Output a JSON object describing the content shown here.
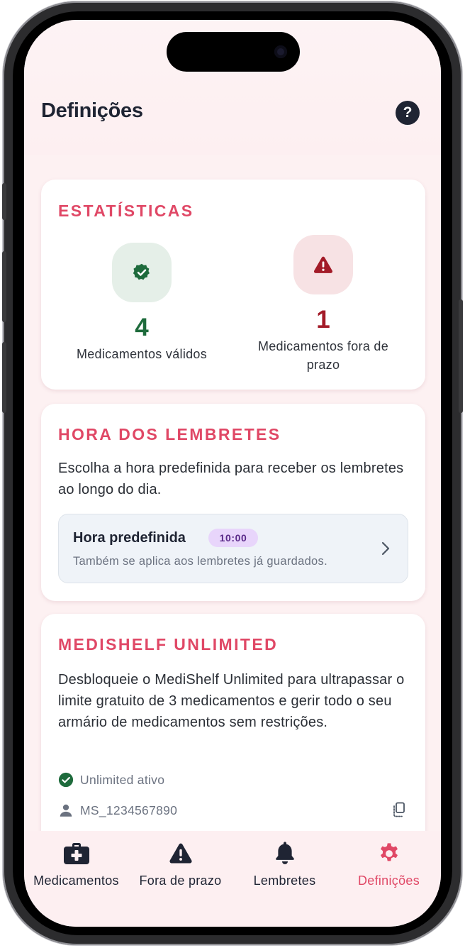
{
  "header": {
    "title": "Definições",
    "help_label": "?"
  },
  "stats": {
    "title": "ESTATÍSTICAS",
    "valid": {
      "count": "4",
      "label": "Medicamentos válidos",
      "icon": "verified-badge-icon",
      "color": "#1e6b3c"
    },
    "expired": {
      "count": "1",
      "label": "Medicamentos fora de prazo",
      "icon": "warning-triangle-icon",
      "color": "#a31b28"
    }
  },
  "reminders": {
    "title": "HORA DOS LEMBRETES",
    "description": "Escolha a hora predefinida para receber os lembretes ao longo do dia.",
    "default_time": {
      "label": "Hora predefinida",
      "time": "10:00",
      "subtitle": "Também se aplica aos lembretes já guardados."
    }
  },
  "unlimited": {
    "title": "MEDISHELF UNLIMITED",
    "description": "Desbloqueie o MediShelf Unlimited para ultrapassar o limite gratuito de 3 medicamentos e gerir todo o seu armário de medicamentos sem restrições.",
    "status": "Unlimited ativo",
    "account_id": "MS_1234567890"
  },
  "tabs": [
    {
      "label": "Medicamentos",
      "icon": "medical-kit-icon",
      "selected": false
    },
    {
      "label": "Fora de prazo",
      "icon": "warning-triangle-icon",
      "selected": false
    },
    {
      "label": "Lembretes",
      "icon": "bell-icon",
      "selected": false
    },
    {
      "label": "Definições",
      "icon": "gear-icon",
      "selected": true
    }
  ],
  "colors": {
    "accent": "#e04866",
    "background": "#fdf1f2",
    "purple_button": "#5b1f8c",
    "badge_bg": "#e8d5fb"
  }
}
